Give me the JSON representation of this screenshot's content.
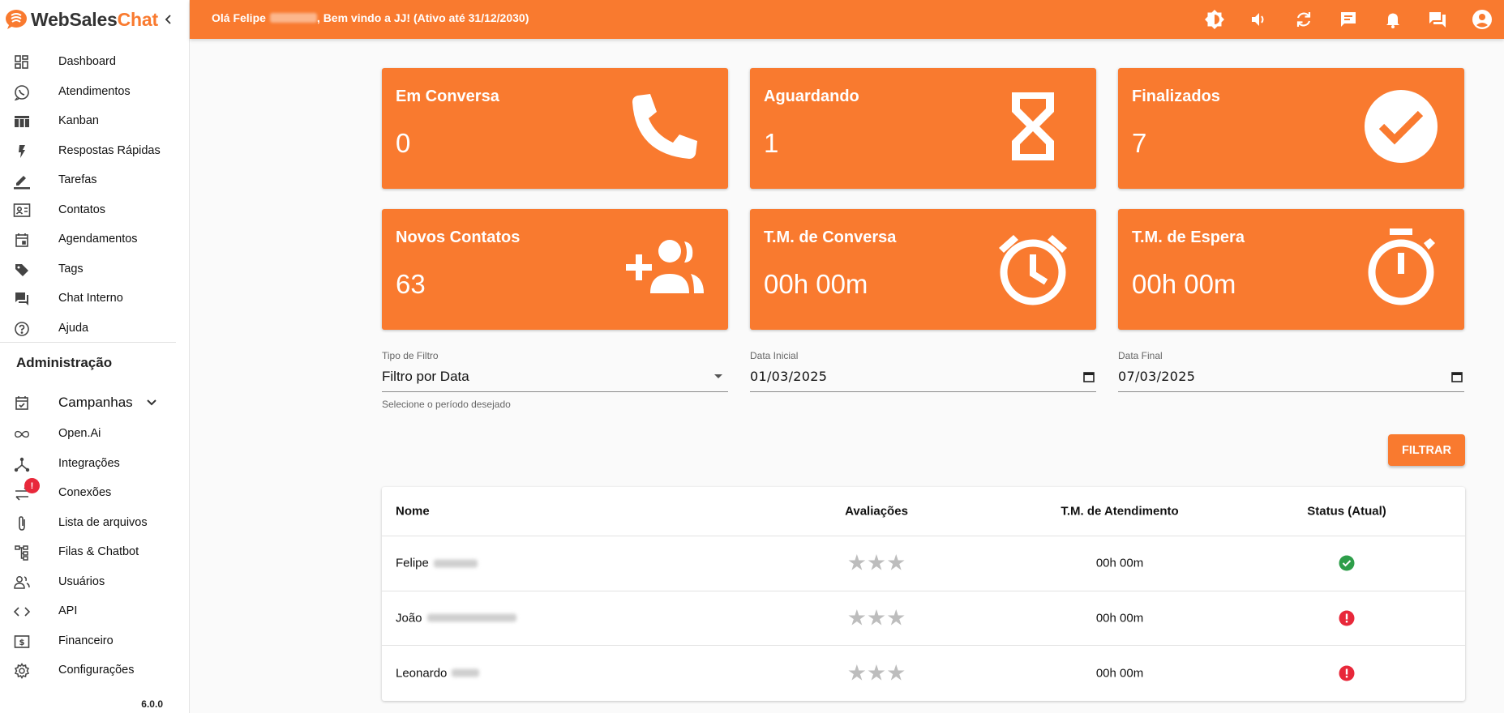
{
  "brand": {
    "name_part1": "WebSales",
    "name_part2": "Chat",
    "accent": "#f97a2f"
  },
  "topbar": {
    "greeting_before": "Olá Felipe",
    "greeting_after": ", Bem vindo a JJ! (Ativo até 31/12/2030)",
    "icons": [
      "brightness-icon",
      "volume-icon",
      "refresh-icon",
      "message-icon",
      "bell-icon",
      "chat-icon",
      "account-icon"
    ]
  },
  "sidebar": {
    "items": [
      {
        "label": "Dashboard",
        "icon": "dashboard-icon"
      },
      {
        "label": "Atendimentos",
        "icon": "whatsapp-icon"
      },
      {
        "label": "Kanban",
        "icon": "kanban-icon"
      },
      {
        "label": "Respostas Rápidas",
        "icon": "flash-icon"
      },
      {
        "label": "Tarefas",
        "icon": "pencil-icon"
      },
      {
        "label": "Contatos",
        "icon": "contacts-icon"
      },
      {
        "label": "Agendamentos",
        "icon": "calendar-icon"
      },
      {
        "label": "Tags",
        "icon": "tag-icon"
      },
      {
        "label": "Chat Interno",
        "icon": "chat-icon"
      },
      {
        "label": "Ajuda",
        "icon": "help-icon"
      }
    ],
    "admin_title": "Administração",
    "admin_items": [
      {
        "label": "Campanhas",
        "icon": "event-check-icon"
      },
      {
        "label": "Open.Ai",
        "icon": "infinity-icon"
      },
      {
        "label": "Integrações",
        "icon": "hub-icon"
      },
      {
        "label": "Conexões",
        "icon": "sync-alt-icon",
        "badge": "!"
      },
      {
        "label": "Lista de arquivos",
        "icon": "paperclip-icon"
      },
      {
        "label": "Filas & Chatbot",
        "icon": "tree-icon"
      },
      {
        "label": "Usuários",
        "icon": "users-icon"
      },
      {
        "label": "API",
        "icon": "code-icon"
      },
      {
        "label": "Financeiro",
        "icon": "money-icon"
      },
      {
        "label": "Configurações",
        "icon": "settings-icon"
      }
    ],
    "version": "6.0.0"
  },
  "cards": [
    {
      "title": "Em Conversa",
      "value": "0",
      "icon": "phone-icon"
    },
    {
      "title": "Aguardando",
      "value": "1",
      "icon": "hourglass-icon"
    },
    {
      "title": "Finalizados",
      "value": "7",
      "icon": "check-circle-icon"
    },
    {
      "title": "Novos Contatos",
      "value": "63",
      "icon": "group-add-icon"
    },
    {
      "title": "T.M. de Conversa",
      "value": "00h 00m",
      "icon": "alarm-icon"
    },
    {
      "title": "T.M. de Espera",
      "value": "00h 00m",
      "icon": "timer-icon"
    }
  ],
  "filters": {
    "type_label": "Tipo de Filtro",
    "type_value": "Filtro por Data",
    "type_helper": "Selecione o período desejado",
    "start_label": "Data Inicial",
    "start_value": "01/03/2025",
    "end_label": "Data Final",
    "end_value": "07/03/2025",
    "button": "FILTRAR"
  },
  "table": {
    "headers": {
      "name": "Nome",
      "rating": "Avaliações",
      "tm": "T.M. de Atendimento",
      "status": "Status (Atual)"
    },
    "rows": [
      {
        "name": "Felipe",
        "stars": "★★★",
        "tm": "00h 00m",
        "status": "online"
      },
      {
        "name": "João",
        "stars": "★★★",
        "tm": "00h 00m",
        "status": "offline"
      },
      {
        "name": "Leonardo",
        "stars": "★★★",
        "tm": "00h 00m",
        "status": "offline"
      }
    ]
  },
  "colors": {
    "primary": "#f97a2f",
    "online": "#2e9e4a",
    "offline": "#e8283a"
  }
}
